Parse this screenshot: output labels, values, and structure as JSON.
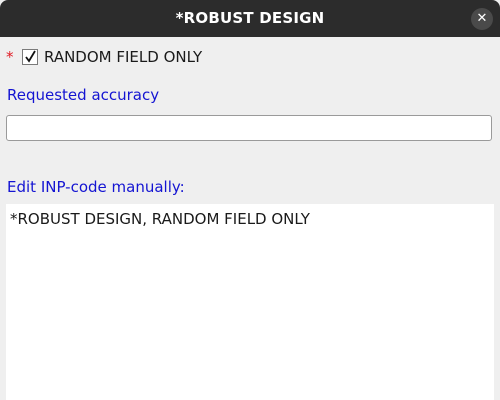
{
  "window": {
    "title": "*ROBUST DESIGN",
    "close_icon": "close-icon"
  },
  "options": {
    "required_marker": "*",
    "random_field_only": {
      "label": "RANDOM FIELD ONLY",
      "checked": true
    }
  },
  "accuracy": {
    "label": "Requested accuracy",
    "value": ""
  },
  "inp_code": {
    "label": "Edit INP-code manually:",
    "value": "*ROBUST DESIGN, RANDOM FIELD ONLY"
  },
  "colors": {
    "titlebar": "#2c2c2c",
    "label_blue": "#1414d2",
    "required_red": "#e01b24",
    "background": "#efefef"
  }
}
